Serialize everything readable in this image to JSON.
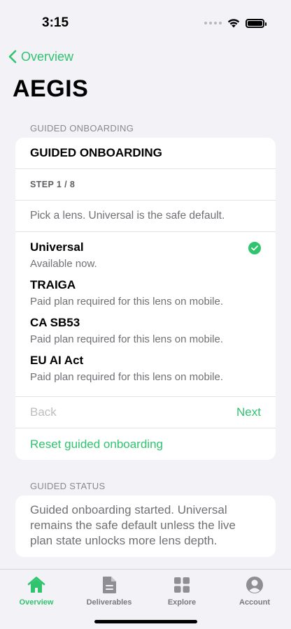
{
  "status_bar": {
    "time": "3:15"
  },
  "nav": {
    "back_label": "Overview"
  },
  "page_title": "AEGIS",
  "onboarding": {
    "section_header": "GUIDED ONBOARDING",
    "card_title": "GUIDED ONBOARDING",
    "step": "STEP 1 / 8",
    "prompt": "Pick a lens. Universal is the safe default.",
    "lenses": [
      {
        "name": "Universal",
        "description": "Available now.",
        "selected": true
      },
      {
        "name": "TRAIGA",
        "description": "Paid plan required for this lens on mobile.",
        "selected": false
      },
      {
        "name": "CA SB53",
        "description": "Paid plan required for this lens on mobile.",
        "selected": false
      },
      {
        "name": "EU AI Act",
        "description": "Paid plan required for this lens on mobile.",
        "selected": false
      }
    ],
    "back_label": "Back",
    "next_label": "Next",
    "reset_label": "Reset guided onboarding"
  },
  "guided_status": {
    "section_header": "GUIDED STATUS",
    "text": "Guided onboarding started. Universal remains the safe default unless the live plan state unlocks more lens depth."
  },
  "tab_bar": {
    "items": [
      {
        "label": "Overview",
        "icon": "house-icon",
        "active": true
      },
      {
        "label": "Deliverables",
        "icon": "document-icon",
        "active": false
      },
      {
        "label": "Explore",
        "icon": "grid-icon",
        "active": false
      },
      {
        "label": "Account",
        "icon": "person-circle-icon",
        "active": false
      }
    ]
  },
  "colors": {
    "accent": "#30c46f",
    "background": "#f2f2f7",
    "secondary_text": "#707075"
  }
}
